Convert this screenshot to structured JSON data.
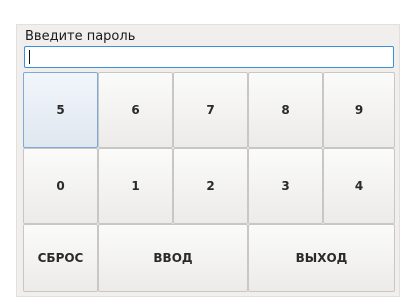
{
  "prompt_label": "Введите пароль",
  "password": {
    "value": "",
    "placeholder": ""
  },
  "keypad": {
    "row1": [
      "5",
      "6",
      "7",
      "8",
      "9"
    ],
    "row2": [
      "0",
      "1",
      "2",
      "3",
      "4"
    ]
  },
  "actions": {
    "reset": "СБРОС",
    "enter": "ВВОД",
    "exit": "ВЫХОД"
  },
  "colors": {
    "focus_border": "#3d8fd6",
    "button_border": "#c9c7c3",
    "dialog_bg": "#f0efee"
  }
}
